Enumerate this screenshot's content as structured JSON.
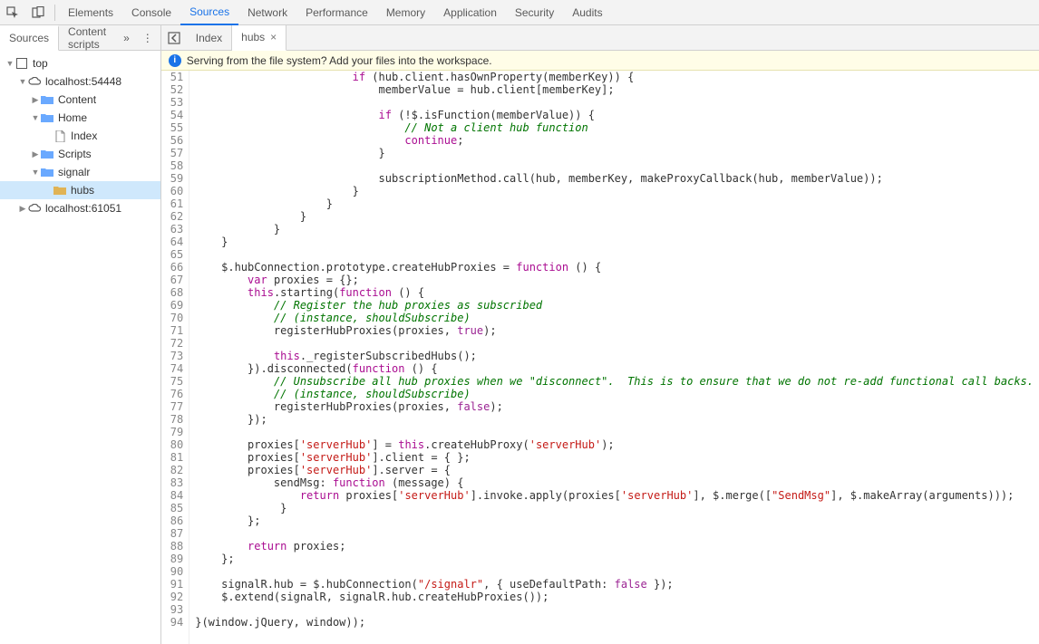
{
  "toolbar": {
    "tabs": [
      "Elements",
      "Console",
      "Sources",
      "Network",
      "Performance",
      "Memory",
      "Application",
      "Security",
      "Audits"
    ],
    "active": "Sources"
  },
  "left": {
    "tabs": [
      "Sources",
      "Content scripts"
    ],
    "active": "Sources",
    "chevrons": "»",
    "dots": "⋮"
  },
  "tree": {
    "items": [
      {
        "indent": 0,
        "arrow": "▼",
        "icon": "frame",
        "label": "top"
      },
      {
        "indent": 1,
        "arrow": "▼",
        "icon": "cloud",
        "label": "localhost:54448"
      },
      {
        "indent": 2,
        "arrow": "▶",
        "icon": "folder",
        "label": "Content"
      },
      {
        "indent": 2,
        "arrow": "▼",
        "icon": "folder",
        "label": "Home"
      },
      {
        "indent": 3,
        "arrow": "",
        "icon": "file",
        "label": "Index"
      },
      {
        "indent": 2,
        "arrow": "▶",
        "icon": "folder",
        "label": "Scripts"
      },
      {
        "indent": 2,
        "arrow": "▼",
        "icon": "folder",
        "label": "signalr"
      },
      {
        "indent": 3,
        "arrow": "",
        "icon": "folder-y",
        "label": "hubs",
        "selected": true
      },
      {
        "indent": 1,
        "arrow": "▶",
        "icon": "cloud",
        "label": "localhost:61051"
      }
    ]
  },
  "fileTabs": {
    "tabs": [
      {
        "label": "Index",
        "closable": false
      },
      {
        "label": "hubs",
        "closable": true,
        "active": true
      }
    ]
  },
  "infobar": {
    "text": "Serving from the file system? Add your files into the workspace."
  },
  "code": {
    "startLine": 51,
    "lines": [
      [
        [
          "",
          "                        "
        ],
        [
          "kw",
          "if"
        ],
        [
          "",
          " (hub.client.hasOwnProperty(memberKey)) {"
        ]
      ],
      [
        [
          "",
          "                            memberValue = hub.client[memberKey];"
        ]
      ],
      [
        [
          "",
          ""
        ]
      ],
      [
        [
          "",
          "                            "
        ],
        [
          "kw",
          "if"
        ],
        [
          "",
          " (!$.isFunction(memberValue)) {"
        ]
      ],
      [
        [
          "",
          "                                "
        ],
        [
          "com",
          "// Not a client hub function"
        ]
      ],
      [
        [
          "",
          "                                "
        ],
        [
          "kw",
          "continue"
        ],
        [
          "",
          ";"
        ]
      ],
      [
        [
          "",
          "                            }"
        ]
      ],
      [
        [
          "",
          ""
        ]
      ],
      [
        [
          "",
          "                            subscriptionMethod.call(hub, memberKey, makeProxyCallback(hub, memberValue));"
        ]
      ],
      [
        [
          "",
          "                        }"
        ]
      ],
      [
        [
          "",
          "                    }"
        ]
      ],
      [
        [
          "",
          "                }"
        ]
      ],
      [
        [
          "",
          "            }"
        ]
      ],
      [
        [
          "",
          "    }"
        ]
      ],
      [
        [
          "",
          ""
        ]
      ],
      [
        [
          "",
          "    $.hubConnection.prototype.createHubProxies = "
        ],
        [
          "kw",
          "function"
        ],
        [
          "",
          " () {"
        ]
      ],
      [
        [
          "",
          "        "
        ],
        [
          "kw",
          "var"
        ],
        [
          "",
          " proxies = {};"
        ]
      ],
      [
        [
          "",
          "        "
        ],
        [
          "kw",
          "this"
        ],
        [
          "",
          ".starting("
        ],
        [
          "kw",
          "function"
        ],
        [
          "",
          " () {"
        ]
      ],
      [
        [
          "",
          "            "
        ],
        [
          "com",
          "// Register the hub proxies as subscribed"
        ]
      ],
      [
        [
          "",
          "            "
        ],
        [
          "com",
          "// (instance, shouldSubscribe)"
        ]
      ],
      [
        [
          "",
          "            registerHubProxies(proxies, "
        ],
        [
          "bool",
          "true"
        ],
        [
          "",
          ");"
        ]
      ],
      [
        [
          "",
          ""
        ]
      ],
      [
        [
          "",
          "            "
        ],
        [
          "kw",
          "this"
        ],
        [
          "",
          "._registerSubscribedHubs();"
        ]
      ],
      [
        [
          "",
          "        }).disconnected("
        ],
        [
          "kw",
          "function"
        ],
        [
          "",
          " () {"
        ]
      ],
      [
        [
          "",
          "            "
        ],
        [
          "com",
          "// Unsubscribe all hub proxies when we \"disconnect\".  This is to ensure that we do not re-add functional call backs."
        ]
      ],
      [
        [
          "",
          "            "
        ],
        [
          "com",
          "// (instance, shouldSubscribe)"
        ]
      ],
      [
        [
          "",
          "            registerHubProxies(proxies, "
        ],
        [
          "bool",
          "false"
        ],
        [
          "",
          ");"
        ]
      ],
      [
        [
          "",
          "        });"
        ]
      ],
      [
        [
          "",
          ""
        ]
      ],
      [
        [
          "",
          "        proxies["
        ],
        [
          "str",
          "'serverHub'"
        ],
        [
          "",
          "] = "
        ],
        [
          "kw",
          "this"
        ],
        [
          "",
          ".createHubProxy("
        ],
        [
          "str",
          "'serverHub'"
        ],
        [
          "",
          ");"
        ]
      ],
      [
        [
          "",
          "        proxies["
        ],
        [
          "str",
          "'serverHub'"
        ],
        [
          "",
          "].client = { };"
        ]
      ],
      [
        [
          "",
          "        proxies["
        ],
        [
          "str",
          "'serverHub'"
        ],
        [
          "",
          "].server = {"
        ]
      ],
      [
        [
          "",
          "            sendMsg: "
        ],
        [
          "kw",
          "function"
        ],
        [
          "",
          " (message) {"
        ]
      ],
      [
        [
          "",
          "                "
        ],
        [
          "kw",
          "return"
        ],
        [
          "",
          " proxies["
        ],
        [
          "str",
          "'serverHub'"
        ],
        [
          "",
          "].invoke.apply(proxies["
        ],
        [
          "str",
          "'serverHub'"
        ],
        [
          "",
          "], $.merge(["
        ],
        [
          "str",
          "\"SendMsg\""
        ],
        [
          "",
          "], $.makeArray(arguments)));"
        ]
      ],
      [
        [
          "",
          "             }"
        ]
      ],
      [
        [
          "",
          "        };"
        ]
      ],
      [
        [
          "",
          ""
        ]
      ],
      [
        [
          "",
          "        "
        ],
        [
          "kw",
          "return"
        ],
        [
          "",
          " proxies;"
        ]
      ],
      [
        [
          "",
          "    };"
        ]
      ],
      [
        [
          "",
          ""
        ]
      ],
      [
        [
          "",
          "    signalR.hub = $.hubConnection("
        ],
        [
          "str",
          "\"/signalr\""
        ],
        [
          "",
          ", { useDefaultPath: "
        ],
        [
          "bool",
          "false"
        ],
        [
          "",
          " });"
        ]
      ],
      [
        [
          "",
          "    $.extend(signalR, signalR.hub.createHubProxies());"
        ]
      ],
      [
        [
          "",
          ""
        ]
      ],
      [
        [
          "",
          "}(window.jQuery, window));"
        ]
      ]
    ]
  }
}
